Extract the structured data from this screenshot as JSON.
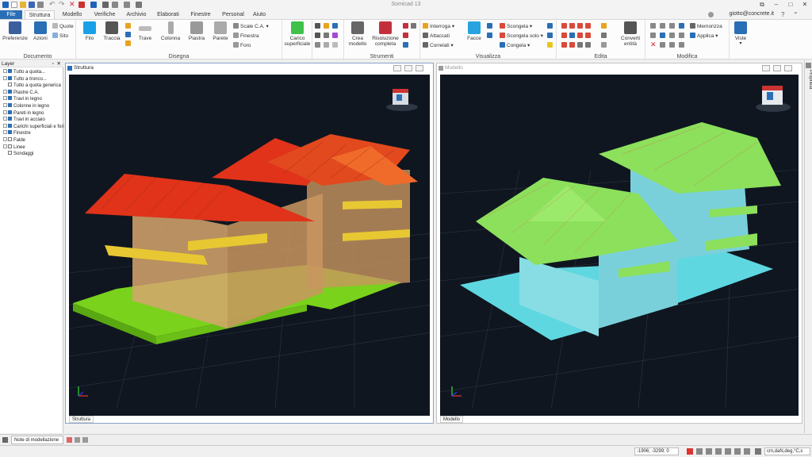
{
  "app": {
    "title": "Somicad 13",
    "user": "giotto@concrete.it"
  },
  "window_controls": {
    "restore": "⧉",
    "minimize": "–",
    "maximize": "□",
    "close": "✕"
  },
  "tabs": [
    "File",
    "Struttura",
    "Modello",
    "Verifiche",
    "Archivio",
    "Elaborati",
    "Finestre",
    "Personal",
    "Aiuto"
  ],
  "ribbon": {
    "documento": {
      "label": "Documento",
      "preferenze": "Preferenze",
      "azioni": "Azioni",
      "quote": "Quote",
      "sito": "Sito"
    },
    "disegna": {
      "label": "Disegna",
      "filo": "Filo",
      "traccia": "Traccia",
      "trave": "Trave",
      "colonna": "Colonna",
      "piastra": "Piastra",
      "parete": "Parete",
      "scale": "Scale C.A.",
      "finestra": "Finestra",
      "foro": "Foro"
    },
    "carico": {
      "label": "Carico superficiale"
    },
    "strumenti": {
      "label": "Strumenti",
      "crea": "Crea modello",
      "risoluzione": "Risoluzione completa"
    },
    "visualizza": {
      "label": "Visualizza",
      "interroga": "Interroga",
      "attaccati": "Attaccati",
      "correlati": "Correlati",
      "facce": "Facce",
      "scongela": "Scongela",
      "scongela_solo": "Scongela solo",
      "congela": "Congela"
    },
    "edita": {
      "label": "Edita",
      "converti": "Converti entità"
    },
    "modifica": {
      "label": "Modifica",
      "memorizza": "Memorizza",
      "applica": "Applica"
    },
    "viste": {
      "label": "Viste"
    }
  },
  "layer_panel": {
    "title": "Layer",
    "items": [
      {
        "label": "Tutto a quota...",
        "checked": true,
        "expand": true
      },
      {
        "label": "Tutto a tronco...",
        "checked": true,
        "expand": true
      },
      {
        "label": "Tutto a quota generica",
        "checked": false,
        "expand": false
      },
      {
        "label": "Piastre C.A.",
        "checked": true,
        "expand": true
      },
      {
        "label": "Travi in legno",
        "checked": true,
        "expand": true
      },
      {
        "label": "Colonne in legno",
        "checked": true,
        "expand": true
      },
      {
        "label": "Pareti in legno",
        "checked": true,
        "expand": true
      },
      {
        "label": "Travi in acciaio",
        "checked": true,
        "expand": true
      },
      {
        "label": "Carichi superficiali e fori",
        "checked": true,
        "expand": true
      },
      {
        "label": "Finestre",
        "checked": true,
        "expand": true
      },
      {
        "label": "Falde",
        "checked": false,
        "expand": true
      },
      {
        "label": "Linee",
        "checked": false,
        "expand": true
      },
      {
        "label": "Sondaggi",
        "checked": false,
        "expand": false
      }
    ]
  },
  "viewports": {
    "struttura": {
      "title": "Struttura",
      "footer": "Struttura"
    },
    "modello": {
      "title": "Modello",
      "footer": "Modello"
    }
  },
  "properties_tab": "Proprietà",
  "bottom": {
    "notes": "Note di modellazione"
  },
  "status": {
    "coords": "-1906; -3299; 0",
    "units": "cm,daN,deg,°C,s"
  },
  "colors": {
    "accent": "#2a6fb5",
    "roof_red": "#e0331a",
    "model_green": "#8ce05c",
    "model_cyan": "#5fd7e0",
    "slab_green": "#7ad21c",
    "wood": "#d6a66d"
  }
}
